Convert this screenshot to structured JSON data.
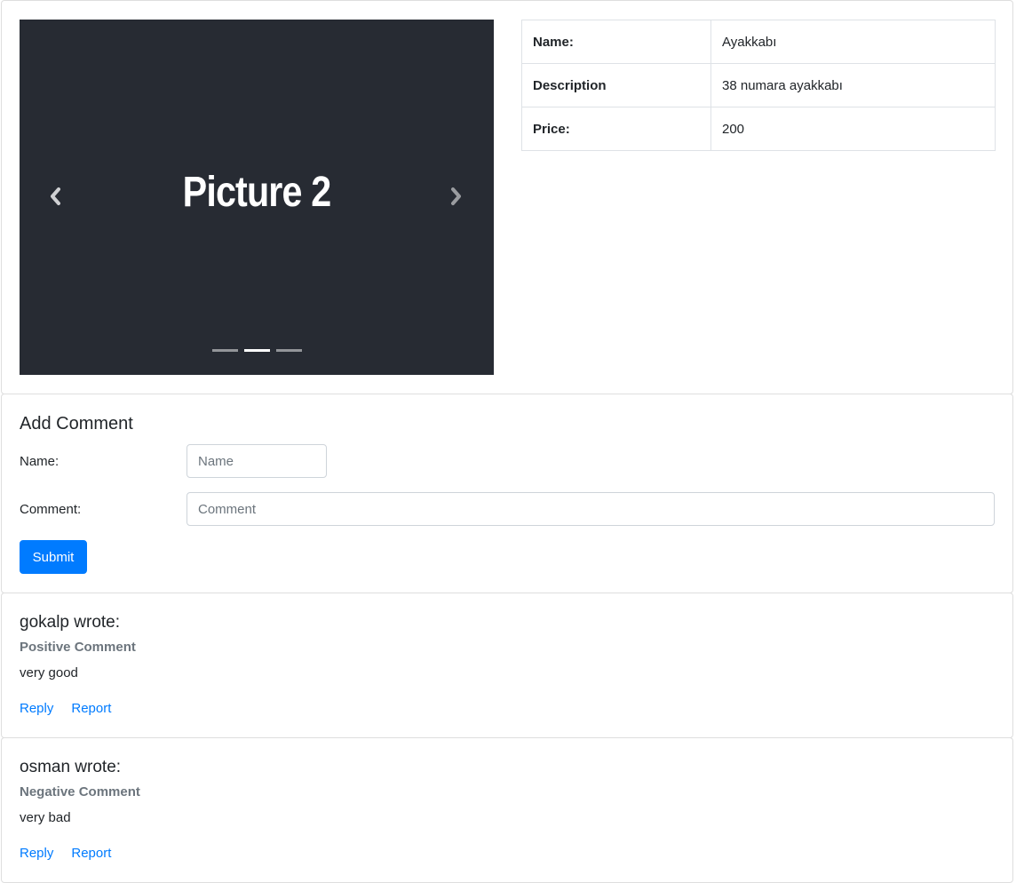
{
  "carousel": {
    "caption": "Picture 2",
    "prev_icon": "chevron-left-icon",
    "next_icon": "chevron-right-icon",
    "indicator_count": 3,
    "active_index": 1
  },
  "product": {
    "rows": [
      {
        "key": "Name:",
        "value": "Ayakkabı"
      },
      {
        "key": "Description",
        "value": "38 numara ayakkabı"
      },
      {
        "key": "Price:",
        "value": "200"
      }
    ]
  },
  "add_comment": {
    "title": "Add Comment",
    "name_label": "Name:",
    "name_placeholder": "Name",
    "comment_label": "Comment:",
    "comment_placeholder": "Comment",
    "submit_label": "Submit",
    "accent_color": "#007bff"
  },
  "comments": [
    {
      "author": "gokalp wrote:",
      "type": "Positive Comment",
      "text": "very good",
      "reply_label": "Reply",
      "report_label": "Report"
    },
    {
      "author": "osman wrote:",
      "type": "Negative Comment",
      "text": "very bad",
      "reply_label": "Reply",
      "report_label": "Report"
    }
  ]
}
